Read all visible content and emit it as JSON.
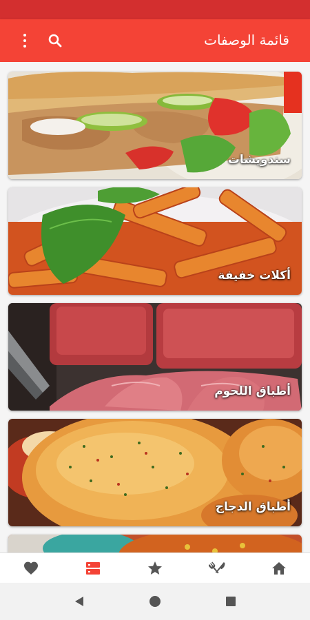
{
  "app_bar": {
    "title": "قائمة الوصفات",
    "icons": [
      "overflow-menu-icon",
      "search-icon"
    ]
  },
  "categories": [
    {
      "label": "سندويشات",
      "image": "sandwich-photo"
    },
    {
      "label": "أكلات خفيفة",
      "image": "pasta-photo"
    },
    {
      "label": "أطباق اللحوم",
      "image": "meat-photo"
    },
    {
      "label": "أطباق الدجاج",
      "image": "chicken-photo"
    },
    {
      "label": "",
      "image": "partial-dish-photo"
    }
  ],
  "bottom_nav": {
    "items": [
      "home-icon",
      "fork-knife-icon",
      "star-icon",
      "list-icon",
      "heart-icon"
    ],
    "active": "list-icon",
    "active_color": "#f44336",
    "inactive_color": "#555555"
  },
  "system_nav": [
    "back-icon",
    "home-circle-icon",
    "recents-icon"
  ],
  "colors": {
    "status_bar": "#d32f2f",
    "app_bar": "#f44336"
  }
}
